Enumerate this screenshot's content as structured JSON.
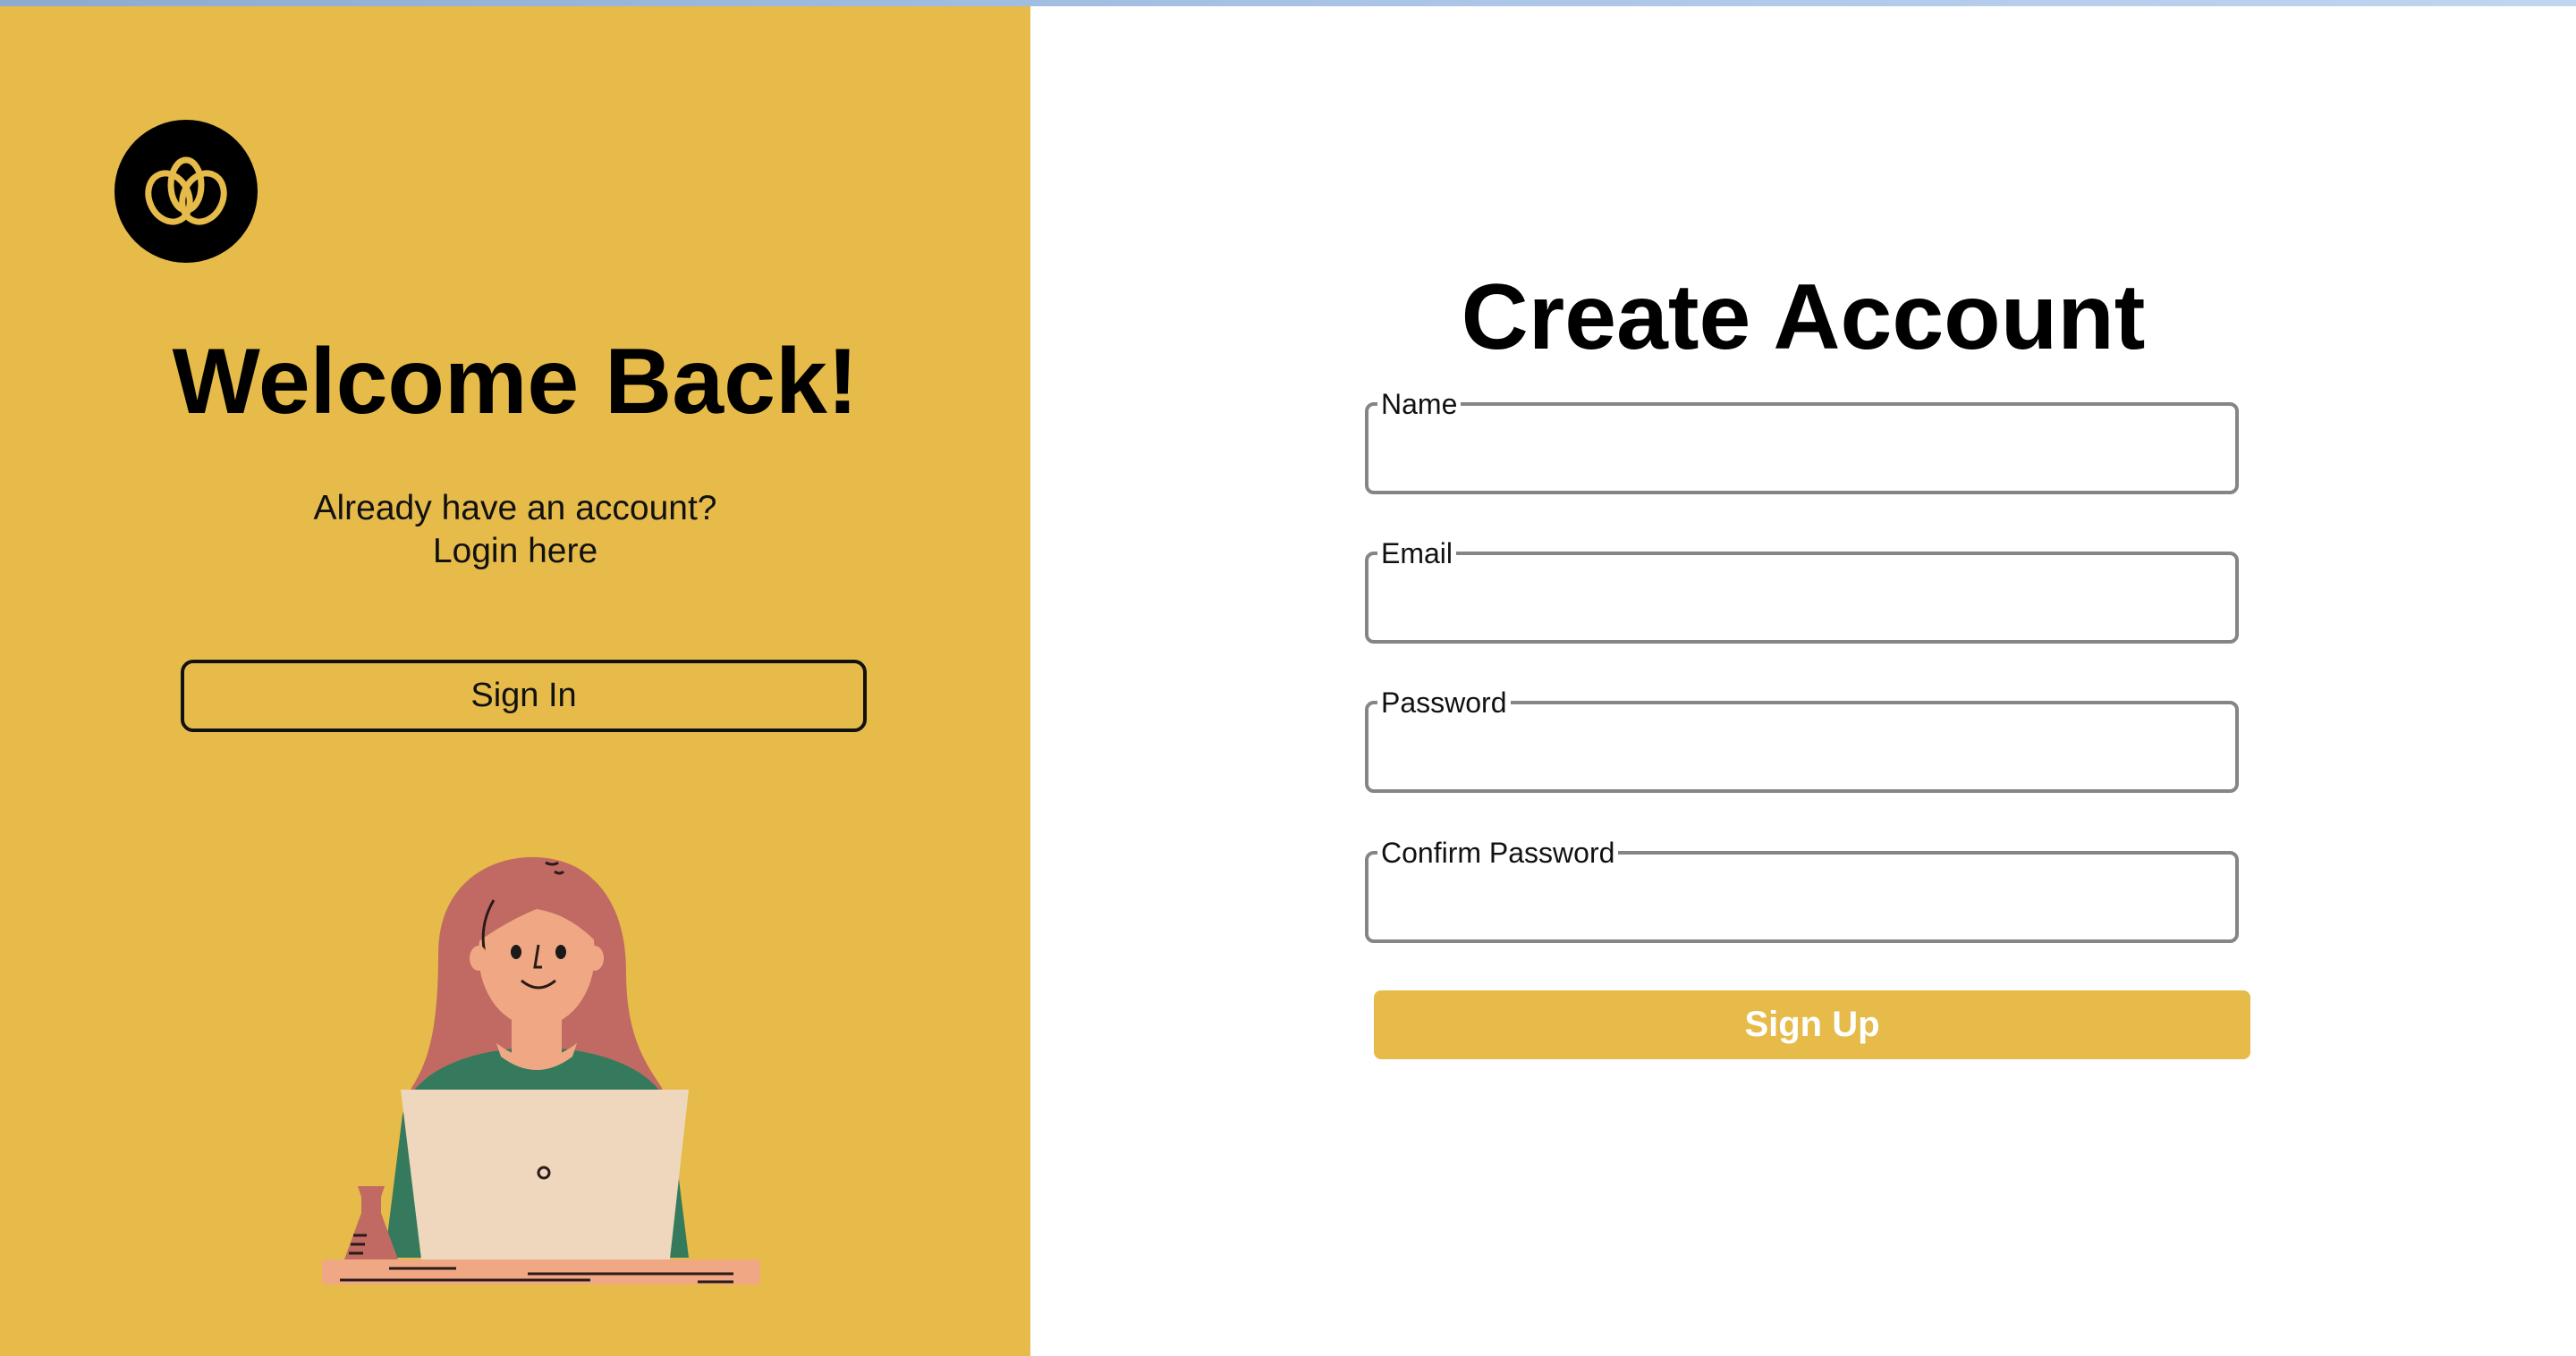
{
  "left_panel": {
    "title": "Welcome Back!",
    "subtitle_line1": "Already have an account?",
    "subtitle_line2": "Login here",
    "signin_label": "Sign In",
    "logo_icon": "triple-petal-logo-icon",
    "illustration": "woman-with-laptop-illustration"
  },
  "form": {
    "title": "Create Account",
    "fields": [
      {
        "label": "Name",
        "value": ""
      },
      {
        "label": "Email",
        "value": ""
      },
      {
        "label": "Password",
        "value": ""
      },
      {
        "label": "Confirm Password",
        "value": ""
      }
    ],
    "submit_label": "Sign Up"
  },
  "colors": {
    "accent": "#e6bb4a",
    "dark": "#000000",
    "field_border": "#858585",
    "background": "#ffffff"
  }
}
